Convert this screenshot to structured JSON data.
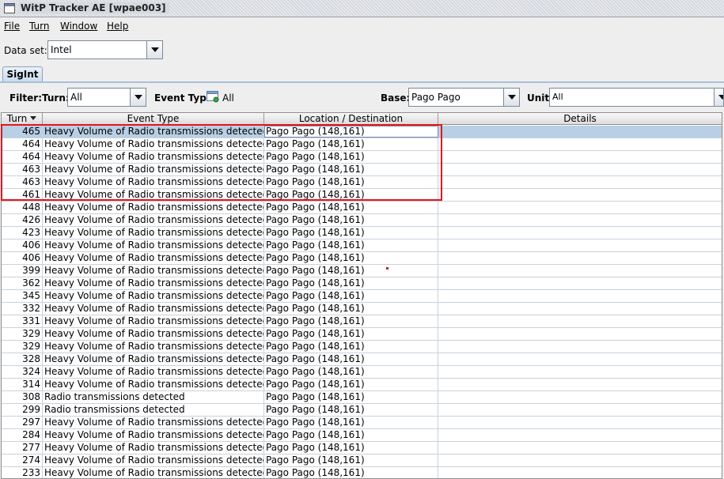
{
  "window": {
    "title": "WitP Tracker AE [wpae003]"
  },
  "menu": [
    "File",
    "Turn",
    "Window",
    "Help"
  ],
  "dataset": {
    "label": "Data set:",
    "value": "Intel"
  },
  "tabs": [
    "SigInt"
  ],
  "filter": {
    "label": "Filter:",
    "turn_label": "Turn:",
    "turn_value": "All",
    "event_type_label": "Event Type:",
    "event_type_value": "All",
    "base_label": "Base:",
    "base_value": "Pago Pago",
    "unit_label": "Unit:",
    "unit_value": "All"
  },
  "table": {
    "columns": [
      "Turn",
      "Event Type",
      "Location / Destination",
      "Details"
    ],
    "rows": [
      [
        "465",
        "Heavy Volume of Radio transmissions detected",
        "Pago Pago (148,161)",
        ""
      ],
      [
        "464",
        "Heavy Volume of Radio transmissions detected",
        "Pago Pago (148,161)",
        ""
      ],
      [
        "464",
        "Heavy Volume of Radio transmissions detected",
        "Pago Pago (148,161)",
        ""
      ],
      [
        "463",
        "Heavy Volume of Radio transmissions detected",
        "Pago Pago (148,161)",
        ""
      ],
      [
        "463",
        "Heavy Volume of Radio transmissions detected",
        "Pago Pago (148,161)",
        ""
      ],
      [
        "461",
        "Heavy Volume of Radio transmissions detected",
        "Pago Pago (148,161)",
        ""
      ],
      [
        "448",
        "Heavy Volume of Radio transmissions detected",
        "Pago Pago (148,161)",
        ""
      ],
      [
        "426",
        "Heavy Volume of Radio transmissions detected",
        "Pago Pago (148,161)",
        ""
      ],
      [
        "423",
        "Heavy Volume of Radio transmissions detected",
        "Pago Pago (148,161)",
        ""
      ],
      [
        "406",
        "Heavy Volume of Radio transmissions detected",
        "Pago Pago (148,161)",
        ""
      ],
      [
        "406",
        "Heavy Volume of Radio transmissions detected",
        "Pago Pago (148,161)",
        ""
      ],
      [
        "399",
        "Heavy Volume of Radio transmissions detected",
        "Pago Pago (148,161)",
        ""
      ],
      [
        "362",
        "Heavy Volume of Radio transmissions detected",
        "Pago Pago (148,161)",
        ""
      ],
      [
        "345",
        "Heavy Volume of Radio transmissions detected",
        "Pago Pago (148,161)",
        ""
      ],
      [
        "332",
        "Heavy Volume of Radio transmissions detected",
        "Pago Pago (148,161)",
        ""
      ],
      [
        "331",
        "Heavy Volume of Radio transmissions detected",
        "Pago Pago (148,161)",
        ""
      ],
      [
        "329",
        "Heavy Volume of Radio transmissions detected",
        "Pago Pago (148,161)",
        ""
      ],
      [
        "329",
        "Heavy Volume of Radio transmissions detected",
        "Pago Pago (148,161)",
        ""
      ],
      [
        "328",
        "Heavy Volume of Radio transmissions detected",
        "Pago Pago (148,161)",
        ""
      ],
      [
        "324",
        "Heavy Volume of Radio transmissions detected",
        "Pago Pago (148,161)",
        ""
      ],
      [
        "314",
        "Heavy Volume of Radio transmissions detected",
        "Pago Pago (148,161)",
        ""
      ],
      [
        "308",
        "Radio transmissions detected",
        "Pago Pago (148,161)",
        ""
      ],
      [
        "299",
        "Radio transmissions detected",
        "Pago Pago (148,161)",
        ""
      ],
      [
        "297",
        "Heavy Volume of Radio transmissions detected",
        "Pago Pago (148,161)",
        ""
      ],
      [
        "284",
        "Heavy Volume of Radio transmissions detected",
        "Pago Pago (148,161)",
        ""
      ],
      [
        "277",
        "Heavy Volume of Radio transmissions detected",
        "Pago Pago (148,161)",
        ""
      ],
      [
        "274",
        "Heavy Volume of Radio transmissions detected",
        "Pago Pago (148,161)",
        ""
      ],
      [
        "233",
        "Heavy Volume of Radio transmissions detected",
        "Pago Pago (148,161)",
        ""
      ]
    ]
  }
}
